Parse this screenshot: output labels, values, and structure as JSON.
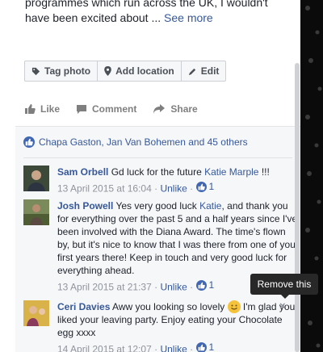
{
  "description": {
    "line1": "programmes which run across the UK, I wouldn't",
    "line2": "have been excited about ...",
    "see_more": "See more"
  },
  "photo_actions": {
    "tag_photo": "Tag photo",
    "add_location": "Add location",
    "edit": "Edit"
  },
  "post_actions": {
    "like": "Like",
    "comment": "Comment",
    "share": "Share"
  },
  "likes_summary": "Chapa Gaston, Jan Van Bohemen and 45 others",
  "comments": [
    {
      "author": "Sam Orbell",
      "text": "Gd luck for the future",
      "mention": "Katie Marple",
      "text_after": "!!!",
      "date": "13 April 2015 at 16:04",
      "unlike": "Unlike",
      "likes": "1"
    },
    {
      "author": "Josh Powell",
      "text": "Yes very good luck",
      "mention": "Katie",
      "text_after": ", and thank you for everything over the past 5 and a half years since I've been involved with the Diana Award. The time's flown by, but it's nice to know that I was there from one of your first years there! Keep in touch and very good luck for everything ahead.",
      "date": "13 April 2015 at 21:37",
      "unlike": "Unlike",
      "likes": "1"
    },
    {
      "author": "Ceri Davies",
      "text": "Aww you looking so lovely",
      "text_after": "I'm glad you liked your leaving party. Enjoy eating your Chocolate egg xxxx",
      "date": "14 April 2015 at 12:07",
      "unlike": "Unlike",
      "likes": "1"
    }
  ],
  "tooltip": "Remove this",
  "remove_icon": "×",
  "separator": "·"
}
